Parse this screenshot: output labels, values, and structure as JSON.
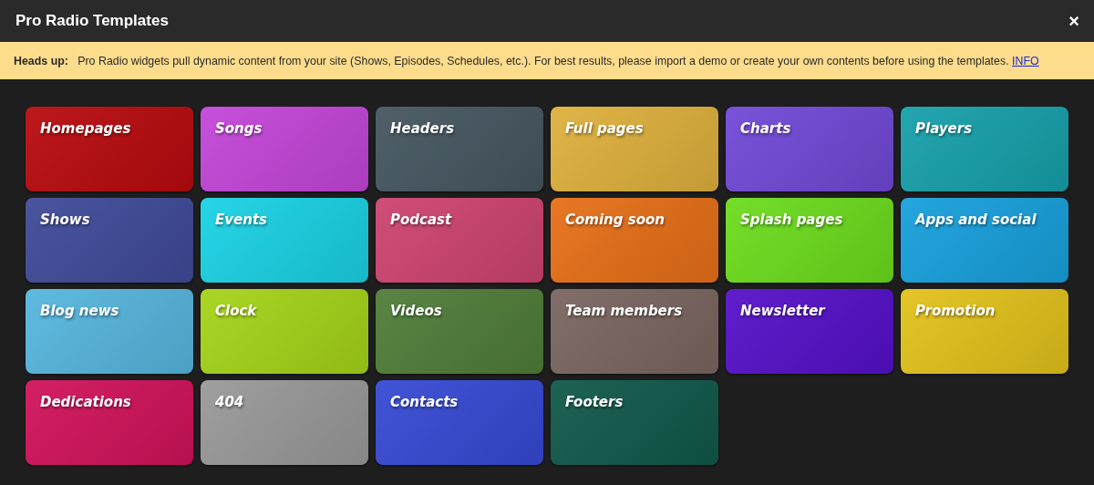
{
  "window": {
    "title": "Pro Radio Templates",
    "close": "×"
  },
  "notice": {
    "label": "Heads up:",
    "text": "Pro Radio widgets pull dynamic content from your site (Shows, Episodes, Schedules, etc.). For best results, please import a demo or create your own contents before using the templates.",
    "link": "INFO"
  },
  "categories": [
    {
      "label": "Homepages",
      "color": "#b80a0e"
    },
    {
      "label": "Songs",
      "color": "#c345d8"
    },
    {
      "label": "Headers",
      "color": "#455660"
    },
    {
      "label": "Full pages",
      "color": "#deb03c"
    },
    {
      "label": "Charts",
      "color": "#7148d6"
    },
    {
      "label": "Players",
      "color": "#16a0aa"
    },
    {
      "label": "Shows",
      "color": "#3f4a98"
    },
    {
      "label": "Events",
      "color": "#19d2e4"
    },
    {
      "label": "Podcast",
      "color": "#cd4370"
    },
    {
      "label": "Coming soon",
      "color": "#e66f17"
    },
    {
      "label": "Splash pages",
      "color": "#6cdc1c"
    },
    {
      "label": "Apps and social",
      "color": "#17a0dc"
    },
    {
      "label": "Blog news",
      "color": "#56b6de"
    },
    {
      "label": "Clock",
      "color": "#a4d418"
    },
    {
      "label": "Videos",
      "color": "#4f7d38"
    },
    {
      "label": "Team members",
      "color": "#7a6560"
    },
    {
      "label": "Newsletter",
      "color": "#5510c8"
    },
    {
      "label": "Promotion",
      "color": "#e2c21a"
    },
    {
      "label": "Dedications",
      "color": "#d0125a"
    },
    {
      "label": "404",
      "color": "#999999"
    },
    {
      "label": "Contacts",
      "color": "#3649d4"
    },
    {
      "label": "Footers",
      "color": "#10594a"
    }
  ]
}
